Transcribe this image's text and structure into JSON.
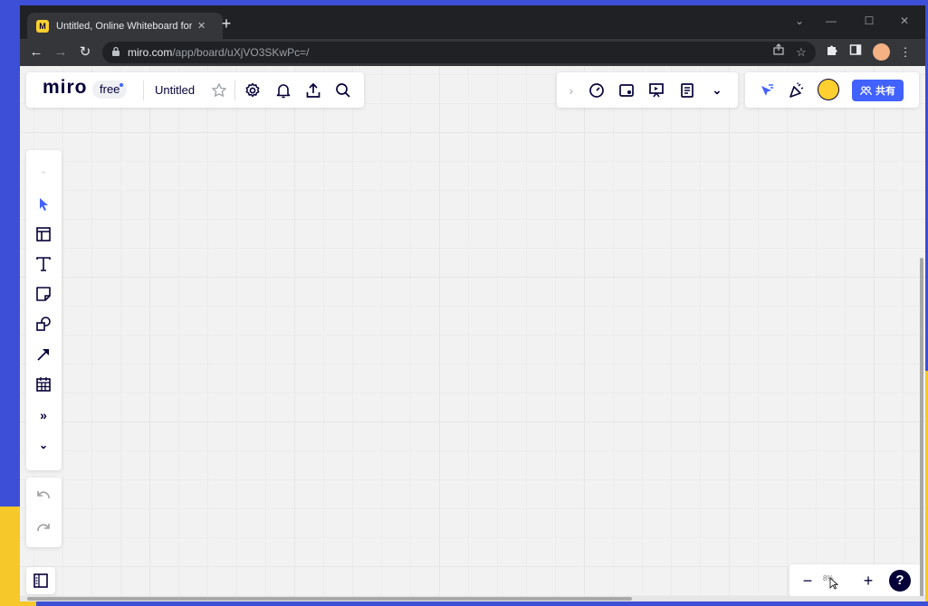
{
  "browser": {
    "tab_title": "Untitled, Online Whiteboard for V",
    "favicon_letter": "M",
    "tab_close": "✕",
    "new_tab": "+",
    "url_host": "miro.com",
    "url_path": "/app/board/uXjVO3SKwPc=/",
    "window_controls": [
      "⌄",
      "—",
      "☐",
      "✕"
    ]
  },
  "header": {
    "logo": "miro",
    "plan_badge": "free",
    "board_name": "Untitled"
  },
  "collab": {
    "share_label": "共有"
  },
  "zoom": {
    "level": "8%"
  },
  "colors": {
    "accent": "#4262ff",
    "brand_yellow": "#ffd02f",
    "ink": "#050038"
  },
  "icons": {
    "toolbar_left": [
      "settings-icon",
      "bell-icon",
      "upload-icon",
      "search-icon"
    ],
    "toolbar_center": [
      "chevron-right-icon",
      "timer-icon",
      "card-icon",
      "presentation-icon",
      "notes-icon",
      "double-chevron-down-icon"
    ],
    "left_tools": [
      "select-icon",
      "frame-icon",
      "text-icon",
      "sticky-note-icon",
      "shapes-icon",
      "arrow-line-icon",
      "calendar-icon",
      "more-tools-icon",
      "collapse-icon"
    ]
  }
}
